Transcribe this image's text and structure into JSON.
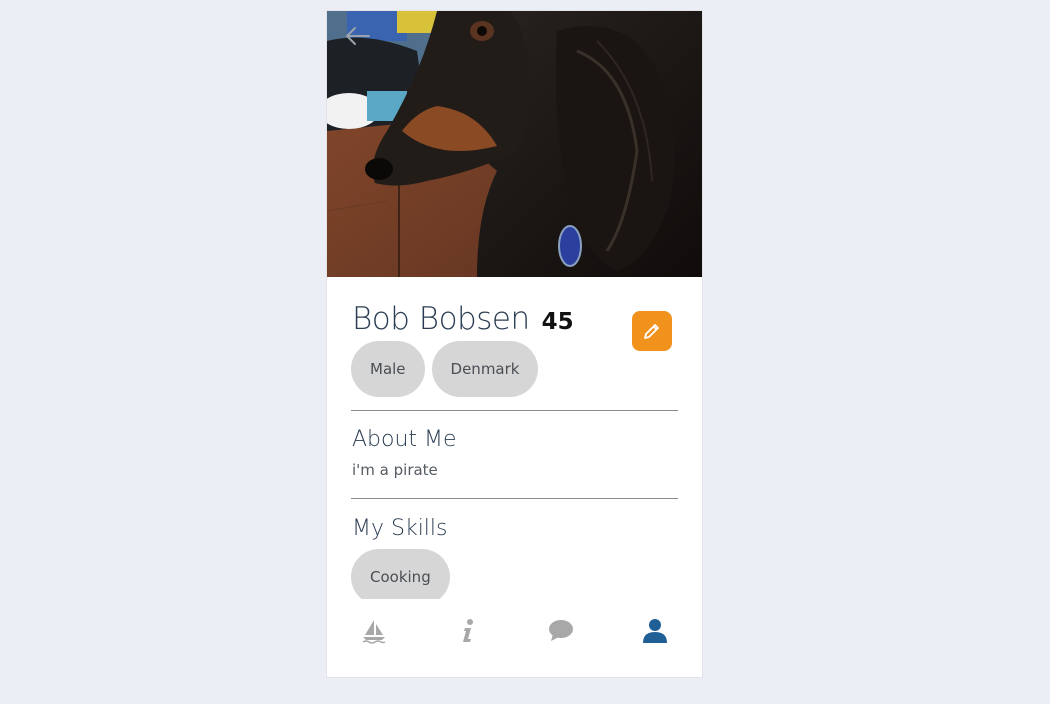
{
  "profile": {
    "name": "Bob Bobsen",
    "age": "45",
    "tags": [
      "Male",
      "Denmark"
    ]
  },
  "about": {
    "title": "About Me",
    "text": "i'm a pirate"
  },
  "skills": {
    "title": "My Skills",
    "items": [
      "Cooking"
    ]
  },
  "icons": {
    "back": "arrow-left-icon",
    "edit": "pencil-icon",
    "nav": [
      "sailboat-icon",
      "info-icon",
      "chat-bubble-icon",
      "user-icon"
    ]
  },
  "colors": {
    "accent": "#f0921c",
    "nav_active": "#1f5f96",
    "nav_inactive": "#a8a8a8",
    "chip": "#d6d6d6",
    "heading": "#2b3d52"
  },
  "nav": {
    "active_index": 3
  }
}
